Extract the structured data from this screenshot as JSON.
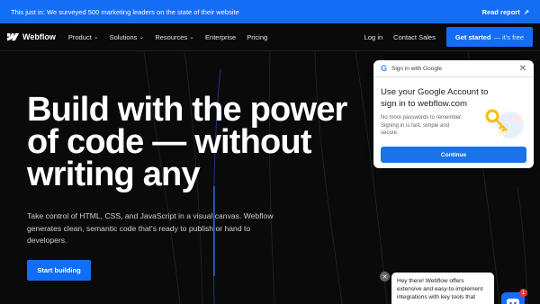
{
  "announcement": {
    "text": "This just in: We surveyed 500 marketing leaders on the state of their website",
    "link_label": "Read report",
    "link_icon": "arrow-right-icon"
  },
  "nav": {
    "logo_text": "Webflow",
    "items": [
      {
        "label": "Product",
        "dropdown": true
      },
      {
        "label": "Solutions",
        "dropdown": true
      },
      {
        "label": "Resources",
        "dropdown": true
      },
      {
        "label": "Enterprise",
        "dropdown": false
      },
      {
        "label": "Pricing",
        "dropdown": false
      }
    ],
    "login": "Log in",
    "contact": "Contact Sales",
    "cta_main": "Get started",
    "cta_suffix": "— it's free"
  },
  "hero": {
    "title": "Build with the power of code — without writing any",
    "subtitle": "Take control of HTML, CSS, and JavaScript in a visual canvas. Webflow generates clean, semantic code that's ready to publish or hand to developers.",
    "cta": "Start building"
  },
  "google_popup": {
    "header": "Sign in with Google",
    "title": "Use your Google Account to sign in to webflow.com",
    "description": "No more passwords to remember. Signing in is fast, simple and secure.",
    "button": "Continue"
  },
  "chat": {
    "message": "Hey there! Webflow offers extensive and easy-to-implement integrations with key tools that",
    "badge_count": "1"
  },
  "colors": {
    "brand_blue": "#146ef5",
    "google_blue": "#1a73e8",
    "background": "#0a0a0a"
  }
}
